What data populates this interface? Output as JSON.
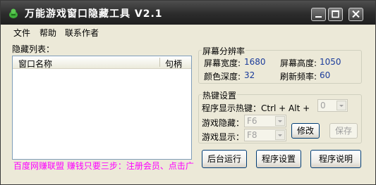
{
  "window": {
    "title": "万能游戏窗口隐藏工具 V2.1"
  },
  "menu": {
    "file": "文件",
    "help": "帮助",
    "contact": "联系作者"
  },
  "hidden_list": {
    "label": "隐藏列表：",
    "columns": [
      "窗口名称",
      "句柄"
    ],
    "rows": []
  },
  "screen_resolution": {
    "title": "屏幕分辨率",
    "width_label": "屏幕宽度:",
    "width_value": "1680",
    "height_label": "屏幕高度:",
    "height_value": "1050",
    "depth_label": "颜色深度:",
    "depth_value": "32",
    "refresh_label": "刷新频率:",
    "refresh_value": "60"
  },
  "hotkeys": {
    "title": "热键设置",
    "show_hotkey_label": "程序显示热键：Ctrl + Alt +",
    "show_hotkey_value": "0",
    "hide_game_label": "游戏隐藏：",
    "hide_game_value": "F6",
    "show_game_label": "游戏显示：",
    "show_game_value": "F8",
    "modify_label": "修改",
    "save_label": "保存"
  },
  "footer": {
    "ad_text": "百度网赚联盟 赚钱只要三步：注册会员、点击广",
    "background_run": "后台运行",
    "settings": "程序设置",
    "help": "程序说明"
  },
  "colors": {
    "titlebar": "#2c2c2c",
    "window_bg": "#ece9d8",
    "value_text": "#1a3b9a",
    "ad_text": "#ff00ff"
  }
}
